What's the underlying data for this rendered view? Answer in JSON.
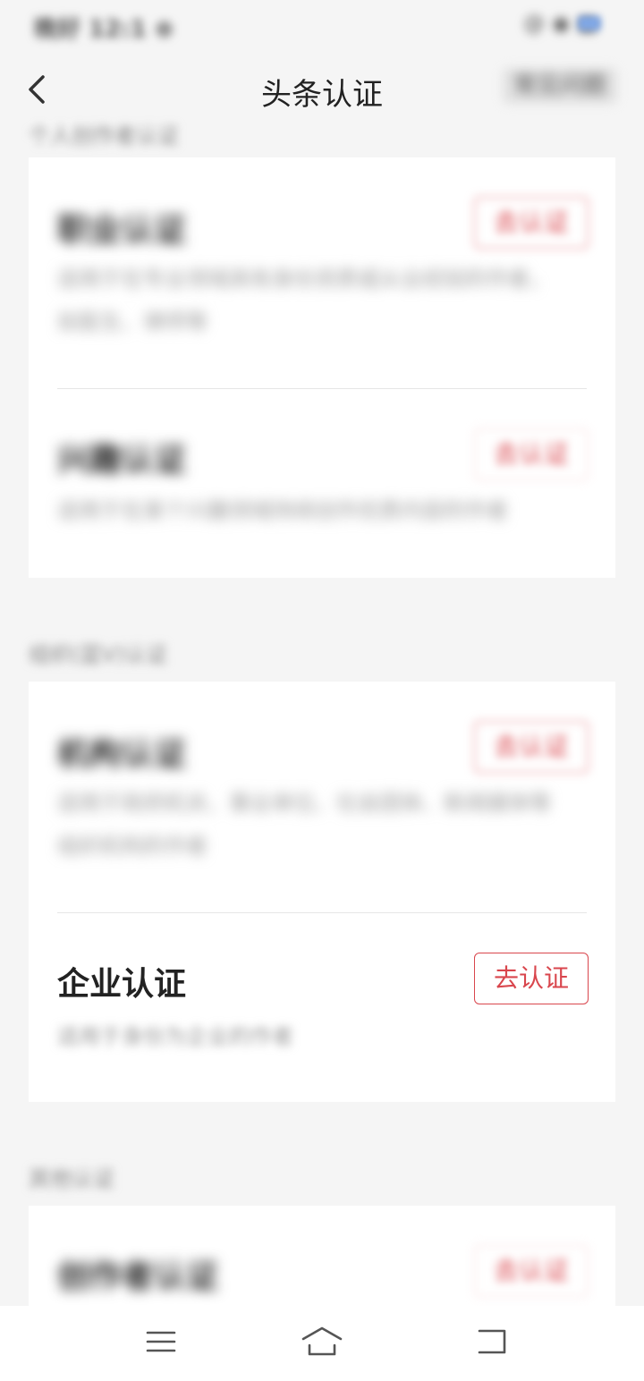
{
  "status_bar": {
    "time": "晚好 12:1 ⊕",
    "right_text": "@ ◉ ▦"
  },
  "nav": {
    "title": "头条认证",
    "right_text": "常见问题",
    "back_icon": "chevron-left-icon"
  },
  "sections": [
    {
      "label": "个人创作者认证",
      "items": [
        {
          "title": "职业认证",
          "desc": "适用于在专业领域具有身份资质或从业经验的作者，如医生、律师等",
          "button": "去认证"
        },
        {
          "title": "兴趣认证",
          "desc": "适用于在某个兴趣领域持续创作优质内容的作者",
          "button": "去认证"
        }
      ]
    },
    {
      "label": "组织(蓝V)认证",
      "items": [
        {
          "title": "机构认证",
          "desc": "适用于政府机关、事业单位、社会团体、新闻媒体等组织机构的作者",
          "button": "去认证"
        },
        {
          "title": "企业认证",
          "desc": "适用于身份为企业的作者",
          "button": "去认证"
        }
      ]
    },
    {
      "label": "其他认证",
      "items": [
        {
          "title": "创作者认证",
          "desc": "",
          "button": "去认证"
        }
      ]
    }
  ],
  "system_nav": {
    "menu_icon": "menu-icon",
    "home_icon": "home-icon",
    "back_icon": "back-icon"
  },
  "colors": {
    "accent": "#d9464d",
    "background": "#f5f5f5",
    "card": "#ffffff"
  }
}
